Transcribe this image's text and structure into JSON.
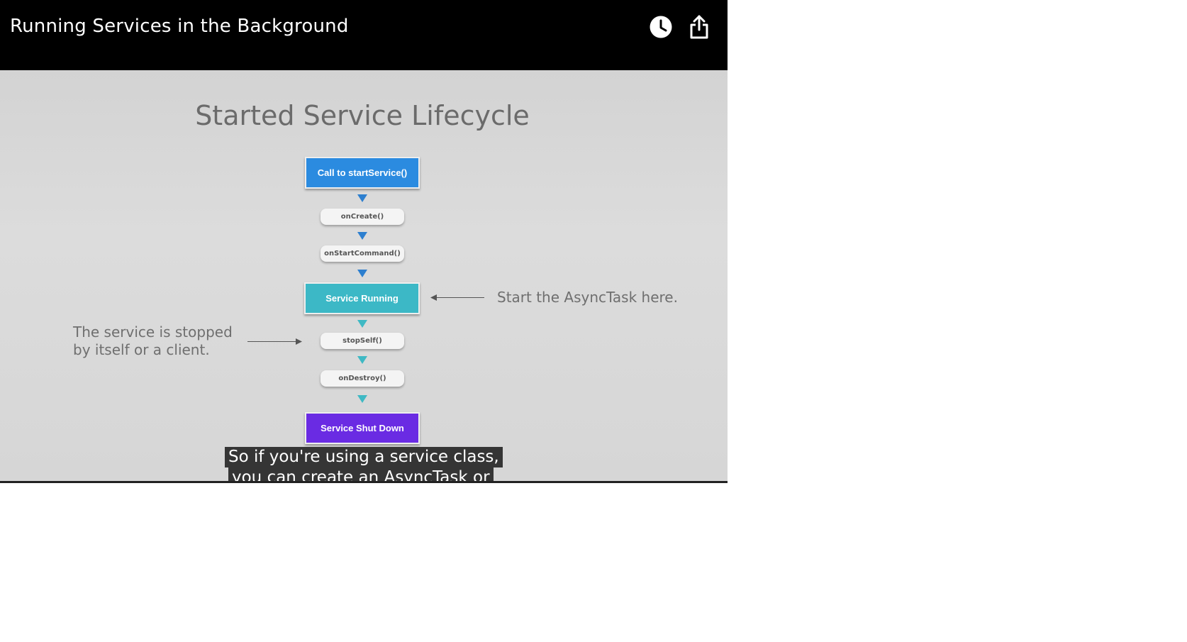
{
  "player": {
    "title": "Running Services in the Background",
    "icons": {
      "watch_later": "clock-icon",
      "share": "share-icon"
    }
  },
  "slide": {
    "title": "Started Service Lifecycle",
    "flow": {
      "start": "Call to startService()",
      "on_create": "onCreate()",
      "on_start_command": "onStartCommand()",
      "running": "Service Running",
      "stop_self": "stopSelf()",
      "on_destroy": "onDestroy()",
      "shut_down": "Service Shut Down"
    },
    "annotation_right": "Start the AsyncTask here.",
    "annotation_left_line1": "The service is stopped",
    "annotation_left_line2": "by itself or a client.",
    "colors": {
      "start_box": "#2b8be0",
      "running_box": "#3cb8c6",
      "shutdown_box": "#6a2be3"
    }
  },
  "captions": {
    "line1": "So if you're using a service class,",
    "line2": "you can create an AsyncTask or"
  }
}
